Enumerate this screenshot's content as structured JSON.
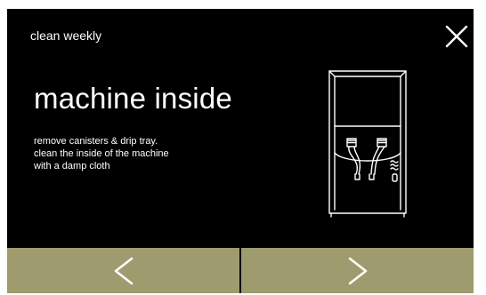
{
  "header": {
    "title": "clean weekly",
    "close_icon": "close-icon"
  },
  "content": {
    "heading": "machine inside",
    "instructions": [
      "remove canisters & drip tray.",
      "clean the inside of the machine",
      "with a damp cloth"
    ],
    "illustration_icon": "machine-inside-icon"
  },
  "navigation": {
    "prev_icon": "chevron-left-icon",
    "next_icon": "chevron-right-icon"
  },
  "colors": {
    "background": "#000000",
    "text": "#ffffff",
    "nav_button": "#9e9c6e"
  }
}
